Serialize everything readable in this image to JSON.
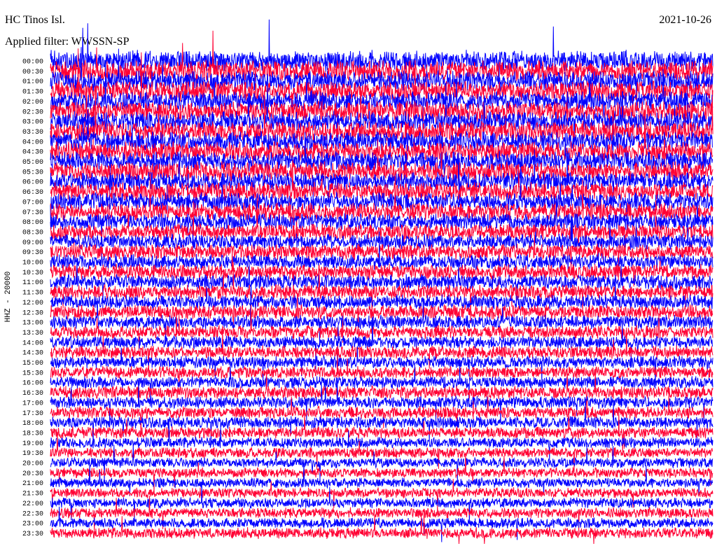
{
  "header": {
    "station": "HC Tinos Isl.",
    "filter": "Applied filter: WWSSN-SP",
    "date": "2021-10-26"
  },
  "chart_data": {
    "type": "line",
    "title": "HC Tinos Isl.",
    "subtitle": "Applied filter: WWSSN-SP",
    "date": "2021-10-26",
    "ylabel": "HHZ - 20000",
    "xlabel": "",
    "trace_interval_minutes": 30,
    "colors": [
      "#0000ff",
      "#ff0033"
    ],
    "grid": false,
    "legend": "none",
    "rows": [
      {
        "label": "00:00",
        "amplitude": 0.95
      },
      {
        "label": "00:30",
        "amplitude": 0.95
      },
      {
        "label": "01:00",
        "amplitude": 0.92
      },
      {
        "label": "01:30",
        "amplitude": 0.92
      },
      {
        "label": "02:00",
        "amplitude": 0.9
      },
      {
        "label": "02:30",
        "amplitude": 0.9
      },
      {
        "label": "03:00",
        "amplitude": 0.9
      },
      {
        "label": "03:30",
        "amplitude": 0.92
      },
      {
        "label": "04:00",
        "amplitude": 0.9
      },
      {
        "label": "04:30",
        "amplitude": 0.88
      },
      {
        "label": "05:00",
        "amplitude": 0.88
      },
      {
        "label": "05:30",
        "amplitude": 0.88
      },
      {
        "label": "06:00",
        "amplitude": 0.85
      },
      {
        "label": "06:30",
        "amplitude": 0.85
      },
      {
        "label": "07:00",
        "amplitude": 0.82
      },
      {
        "label": "07:30",
        "amplitude": 0.8
      },
      {
        "label": "08:00",
        "amplitude": 0.75
      },
      {
        "label": "08:30",
        "amplitude": 0.72
      },
      {
        "label": "09:00",
        "amplitude": 0.7
      },
      {
        "label": "09:30",
        "amplitude": 0.7
      },
      {
        "label": "10:00",
        "amplitude": 0.68
      },
      {
        "label": "10:30",
        "amplitude": 0.68
      },
      {
        "label": "11:00",
        "amplitude": 0.68
      },
      {
        "label": "11:30",
        "amplitude": 0.66
      },
      {
        "label": "12:00",
        "amplitude": 0.65
      },
      {
        "label": "12:30",
        "amplitude": 0.65
      },
      {
        "label": "13:00",
        "amplitude": 0.62
      },
      {
        "label": "13:30",
        "amplitude": 0.6
      },
      {
        "label": "14:00",
        "amplitude": 0.58
      },
      {
        "label": "14:30",
        "amplitude": 0.58
      },
      {
        "label": "15:00",
        "amplitude": 0.56
      },
      {
        "label": "15:30",
        "amplitude": 0.55
      },
      {
        "label": "16:00",
        "amplitude": 0.55
      },
      {
        "label": "16:30",
        "amplitude": 0.58
      },
      {
        "label": "17:00",
        "amplitude": 0.55
      },
      {
        "label": "17:30",
        "amplitude": 0.55
      },
      {
        "label": "18:00",
        "amplitude": 0.55
      },
      {
        "label": "18:30",
        "amplitude": 0.52
      },
      {
        "label": "19:00",
        "amplitude": 0.5
      },
      {
        "label": "19:30",
        "amplitude": 0.48
      },
      {
        "label": "20:00",
        "amplitude": 0.46
      },
      {
        "label": "20:30",
        "amplitude": 0.46
      },
      {
        "label": "21:00",
        "amplitude": 0.46
      },
      {
        "label": "21:30",
        "amplitude": 0.46
      },
      {
        "label": "22:00",
        "amplitude": 0.48
      },
      {
        "label": "22:30",
        "amplitude": 0.48
      },
      {
        "label": "23:00",
        "amplitude": 0.48
      },
      {
        "label": "23:30",
        "amplitude": 0.5
      }
    ]
  }
}
